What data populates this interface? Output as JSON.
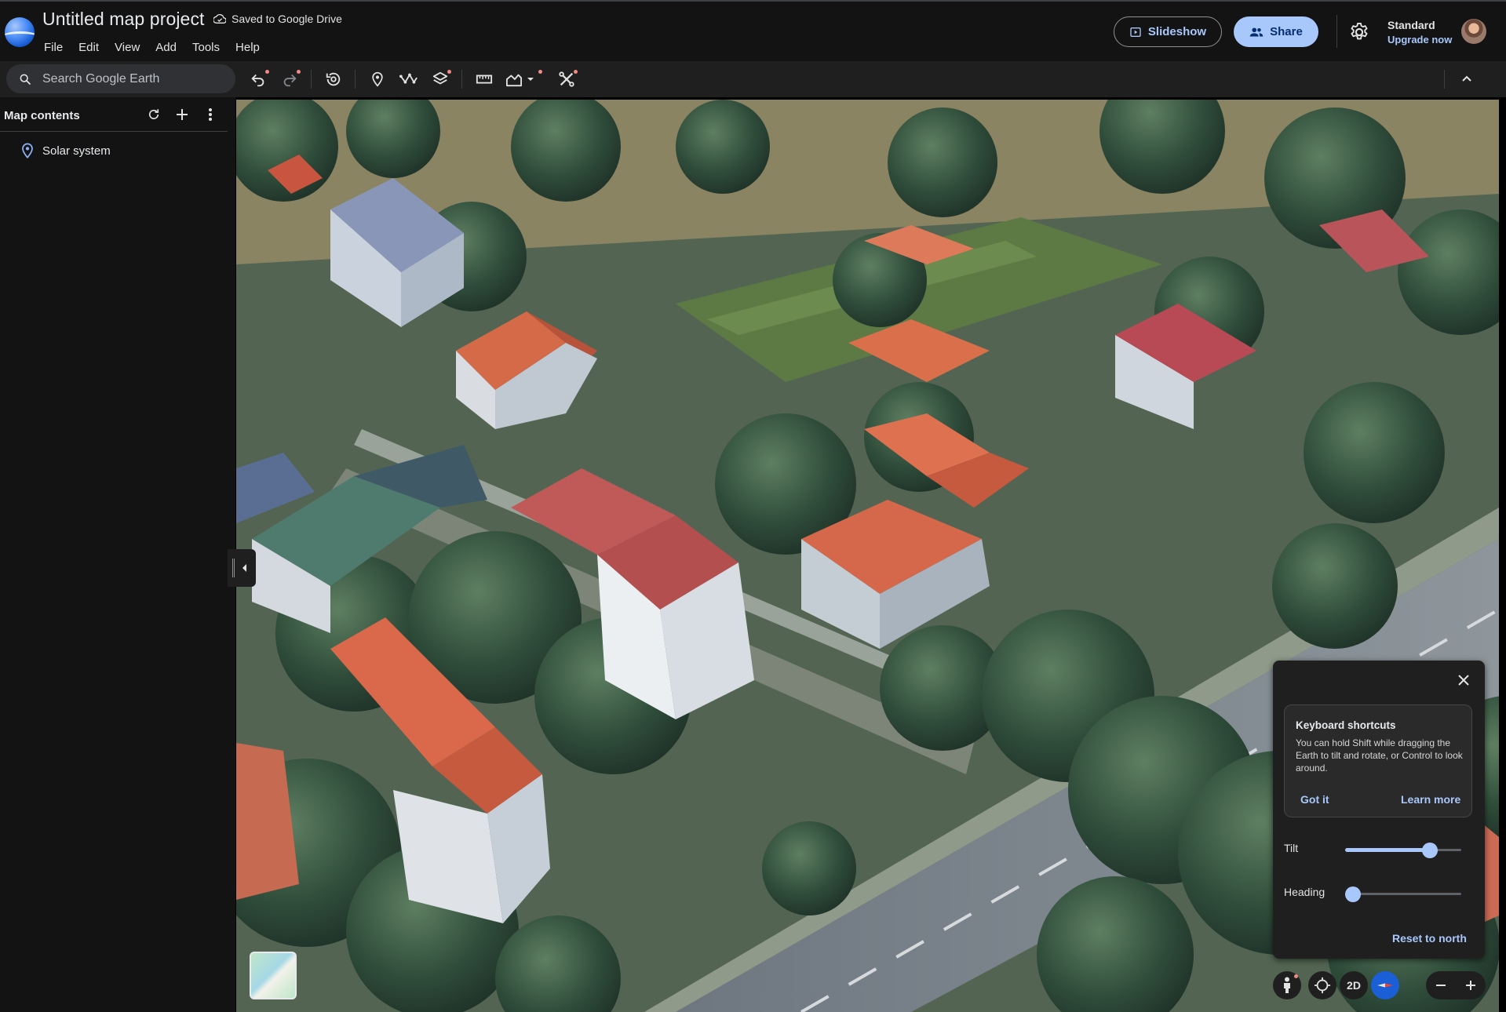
{
  "header": {
    "project_title": "Untitled map project",
    "save_status": "Saved to Google Drive",
    "menu": [
      "File",
      "Edit",
      "View",
      "Add",
      "Tools",
      "Help"
    ],
    "slideshow_label": "Slideshow",
    "share_label": "Share",
    "plan_name": "Standard",
    "upgrade_label": "Upgrade now"
  },
  "search": {
    "placeholder": "Search Google Earth",
    "value": ""
  },
  "toolbar": {
    "icons": [
      "undo-icon",
      "redo-icon",
      "history-icon",
      "add-placemark-icon",
      "add-path-icon",
      "map-style-icon",
      "measure-icon",
      "elevation-icon",
      "custom-tools-icon",
      "collapse-icon"
    ]
  },
  "sidebar": {
    "title": "Map contents",
    "items": [
      {
        "label": "Solar system",
        "icon": "placemark-icon"
      }
    ]
  },
  "help_popup": {
    "tip_title": "Keyboard shortcuts",
    "tip_body": "You can hold Shift while dragging the Earth to tilt and rotate, or Control to look around.",
    "got_it": "Got it",
    "learn_more": "Learn more",
    "tilt_label": "Tilt",
    "tilt_value": 0.73,
    "heading_label": "Heading",
    "heading_value": 0.0,
    "reset_label": "Reset to north"
  },
  "map_controls": {
    "view_mode_label": "2D",
    "buttons": [
      "pegman-icon",
      "my-location-icon",
      "2d-toggle",
      "compass-icon",
      "zoom-out-icon",
      "zoom-in-icon"
    ]
  },
  "colors": {
    "accent": "#a8c7fa",
    "panel_bg": "#131314",
    "toolbar_bg": "#1f1f1f",
    "notification_dot": "#f28b82"
  }
}
